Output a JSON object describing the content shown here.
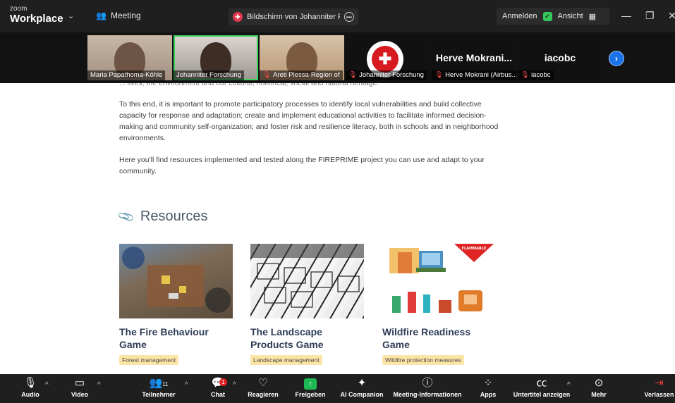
{
  "topbar": {
    "brand_small": "zoom",
    "brand_main": "Workplace",
    "meeting_label": "Meeting",
    "share_tab_text": "Bildschirm von Johanniter Forschung",
    "sign_in": "Anmelden",
    "view_label": "Ansicht"
  },
  "participants": [
    {
      "name": "Maria Papathoma-Köhle",
      "muted": false
    },
    {
      "name": "Johanniter Forschung",
      "muted": false
    },
    {
      "name": "Areti Plessa-Region of",
      "muted": true
    },
    {
      "name": "Johanniter Forschung",
      "muted": true
    },
    {
      "name": "Herve Mokrani (Airbus...",
      "muted": true,
      "display": "Herve Mokrani..."
    },
    {
      "name": "iacobc",
      "muted": true,
      "display": "iacobc"
    }
  ],
  "content": {
    "para0": "... lives, the environment and our cultural, historical, social and natural heritage.",
    "para1": "To this end, it is important to promote participatory processes to identify local vulnerabilities and build collective capacity for response and adaptation; create and implement educational activities to facilitate informed decision-making and community self-organization; and foster risk and resilience literacy, both in schools and in neighborhood environments.",
    "para2": "Here you'll find resources implemented and tested along the FIREPRIME project you can use and adapt to your community.",
    "resources_title": "Resources",
    "cards": [
      {
        "title": "The Fire Behaviour Game",
        "tag": "Forest management"
      },
      {
        "title": "The Landscape Products Game",
        "tag": "Landscape management"
      },
      {
        "title": "Wildfire Readiness Game",
        "tag": "Wildfire protection measures",
        "sign_text": "FLAMMABLE"
      }
    ]
  },
  "toolbar": {
    "audio": "Audio",
    "video": "Video",
    "participants": "Teilnehmer",
    "participants_count": "11",
    "chat": "Chat",
    "chat_badge": "1",
    "react": "Reagieren",
    "share": "Freigeben",
    "ai": "AI Companion",
    "info": "Meeting-Informationen",
    "apps": "Apps",
    "captions": "Untertitel anzeigen",
    "more": "Mehr",
    "leave": "Verlassen"
  }
}
